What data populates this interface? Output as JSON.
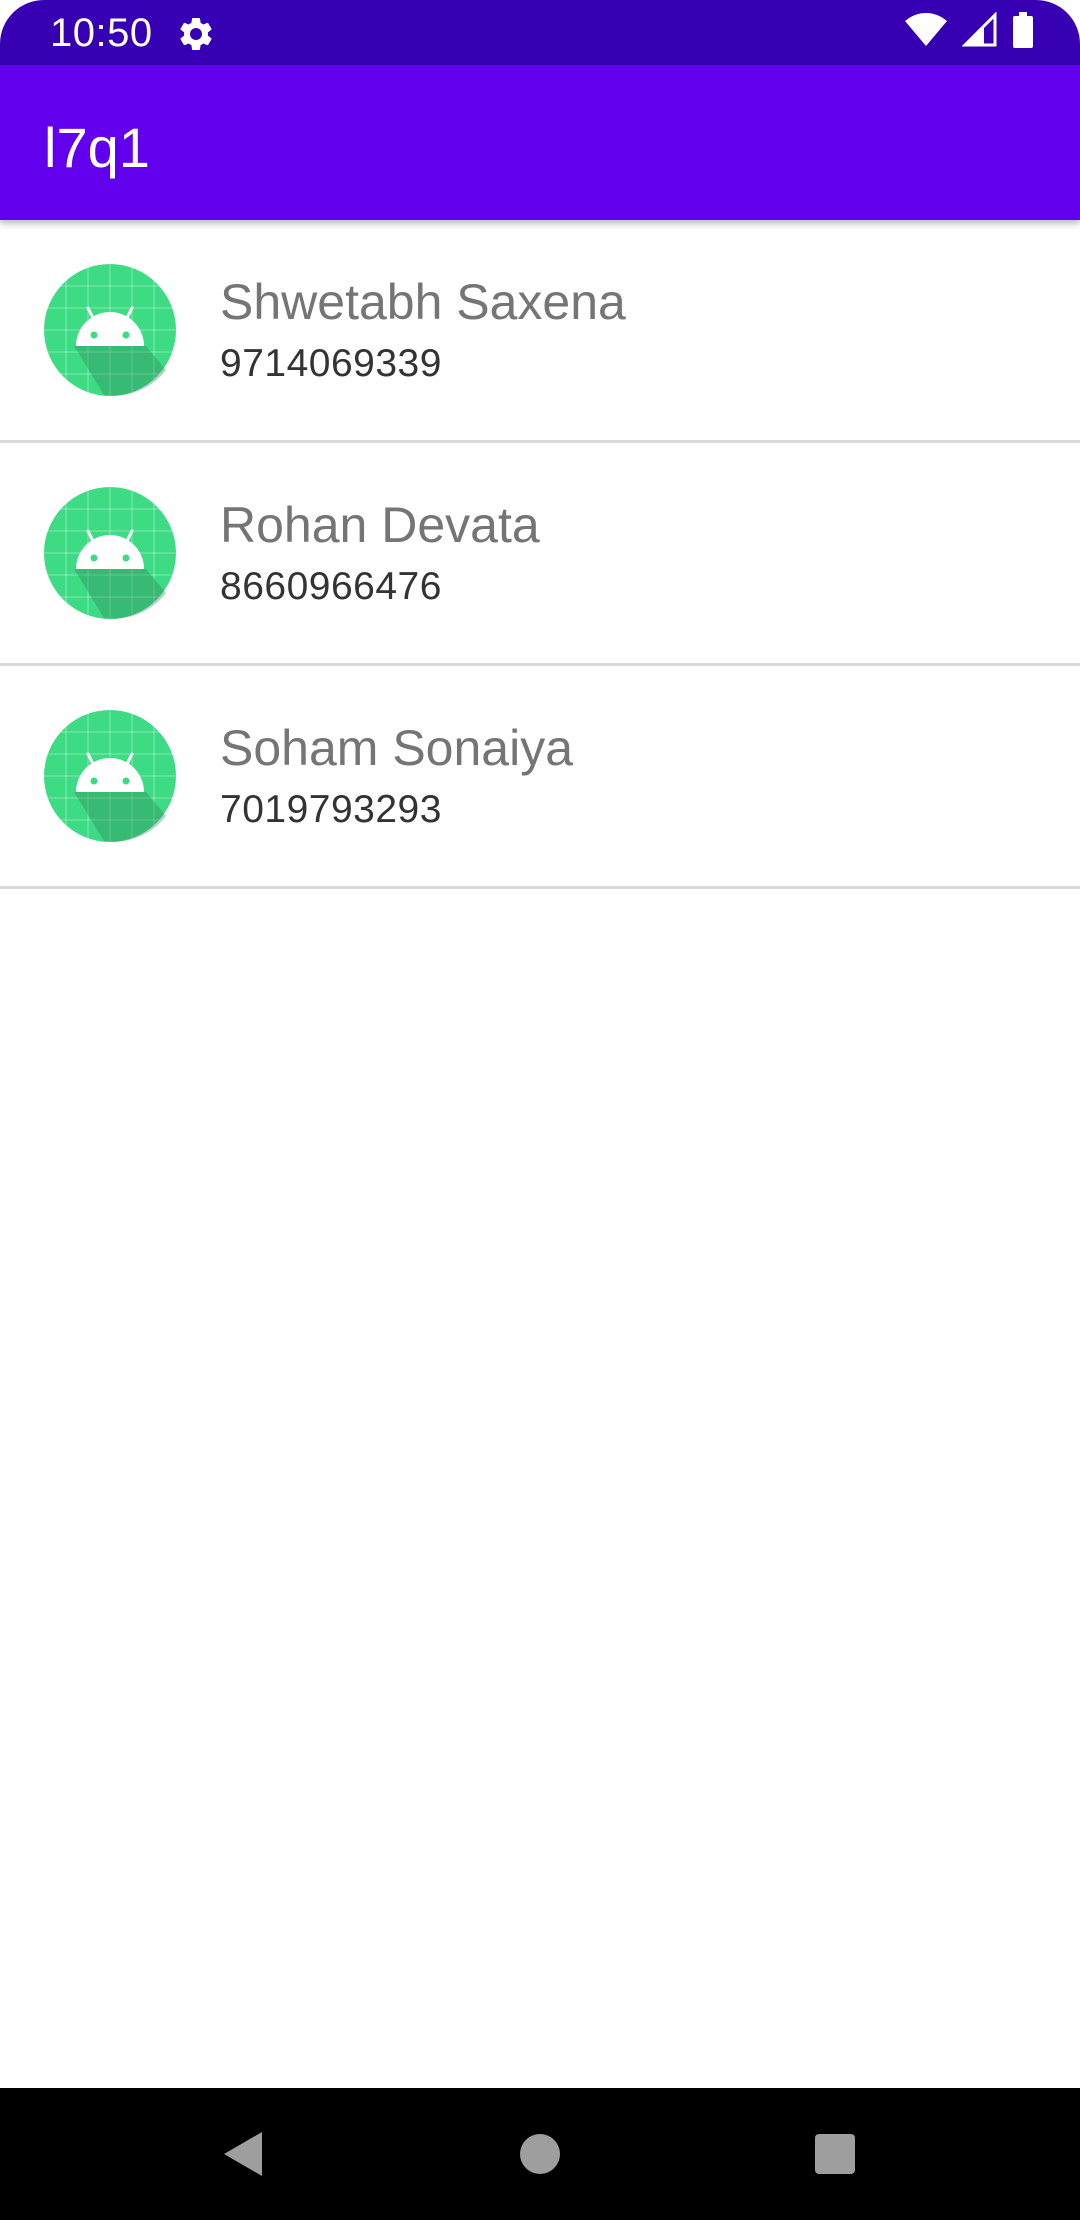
{
  "status_bar": {
    "time": "10:50",
    "icons": [
      "settings-gear-icon",
      "wifi-icon",
      "cell-signal-icon",
      "battery-icon"
    ],
    "background_color": "#3700B3"
  },
  "app_bar": {
    "title": "l7q1",
    "background_color": "#6200EE"
  },
  "contacts": [
    {
      "name": "Shwetabh Saxena",
      "phone": "9714069339",
      "avatar_icon": "android-avatar-icon"
    },
    {
      "name": "Rohan Devata",
      "phone": "8660966476",
      "avatar_icon": "android-avatar-icon"
    },
    {
      "name": "Soham Sonaiya",
      "phone": "7019793293",
      "avatar_icon": "android-avatar-icon"
    }
  ],
  "navigation_bar": {
    "buttons": [
      "back-icon",
      "home-icon",
      "recents-icon"
    ],
    "background_color": "#000000"
  },
  "colors": {
    "avatar_green": "#3DDC84",
    "name_text": "#757575",
    "phone_text": "#333333",
    "divider": "#D9D9D9"
  }
}
